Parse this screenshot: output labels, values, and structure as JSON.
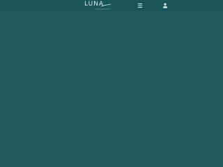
{
  "header": {
    "logo_text": "LUNA",
    "menu_icon": "hamburger-menu-icon",
    "user_icon": "user-icon"
  },
  "colors": {
    "background": "#1e5a5c",
    "topbar": "#1c5557",
    "foreground": "#d7eef0"
  }
}
